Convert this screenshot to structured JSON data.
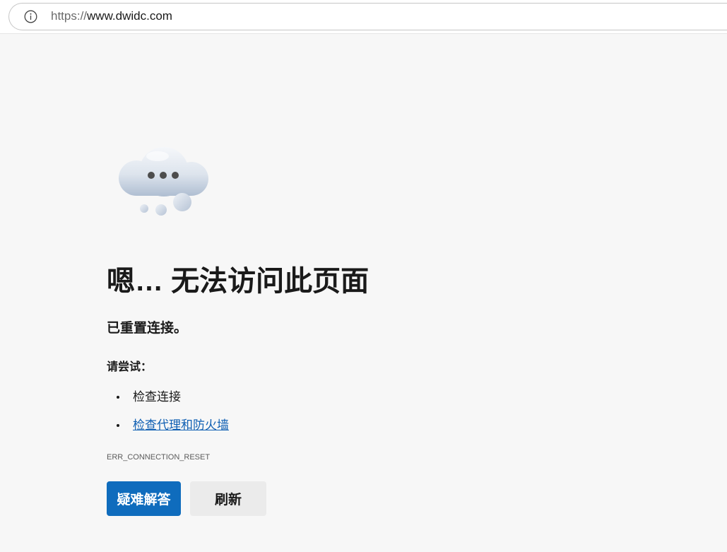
{
  "browser": {
    "address_bar": {
      "icon": "info-icon",
      "url_scheme": "https://",
      "url_host": "www.dwidc.com"
    }
  },
  "error_page": {
    "illustration": "cloud-icon",
    "title": "嗯… 无法访问此页面",
    "subtitle": "已重置连接。",
    "try_label": "请尝试：",
    "suggestions": [
      "检查连接",
      "检查代理和防火墙"
    ],
    "error_code": "ERR_CONNECTION_RESET",
    "buttons": {
      "troubleshoot_label": "疑难解答",
      "refresh_label": "刷新"
    }
  },
  "colors": {
    "background": "#f7f7f7",
    "text": "#1a1a1a",
    "link": "#0f5fb3",
    "primary_button": "#0f6cbd",
    "secondary_button": "#ebebeb"
  }
}
